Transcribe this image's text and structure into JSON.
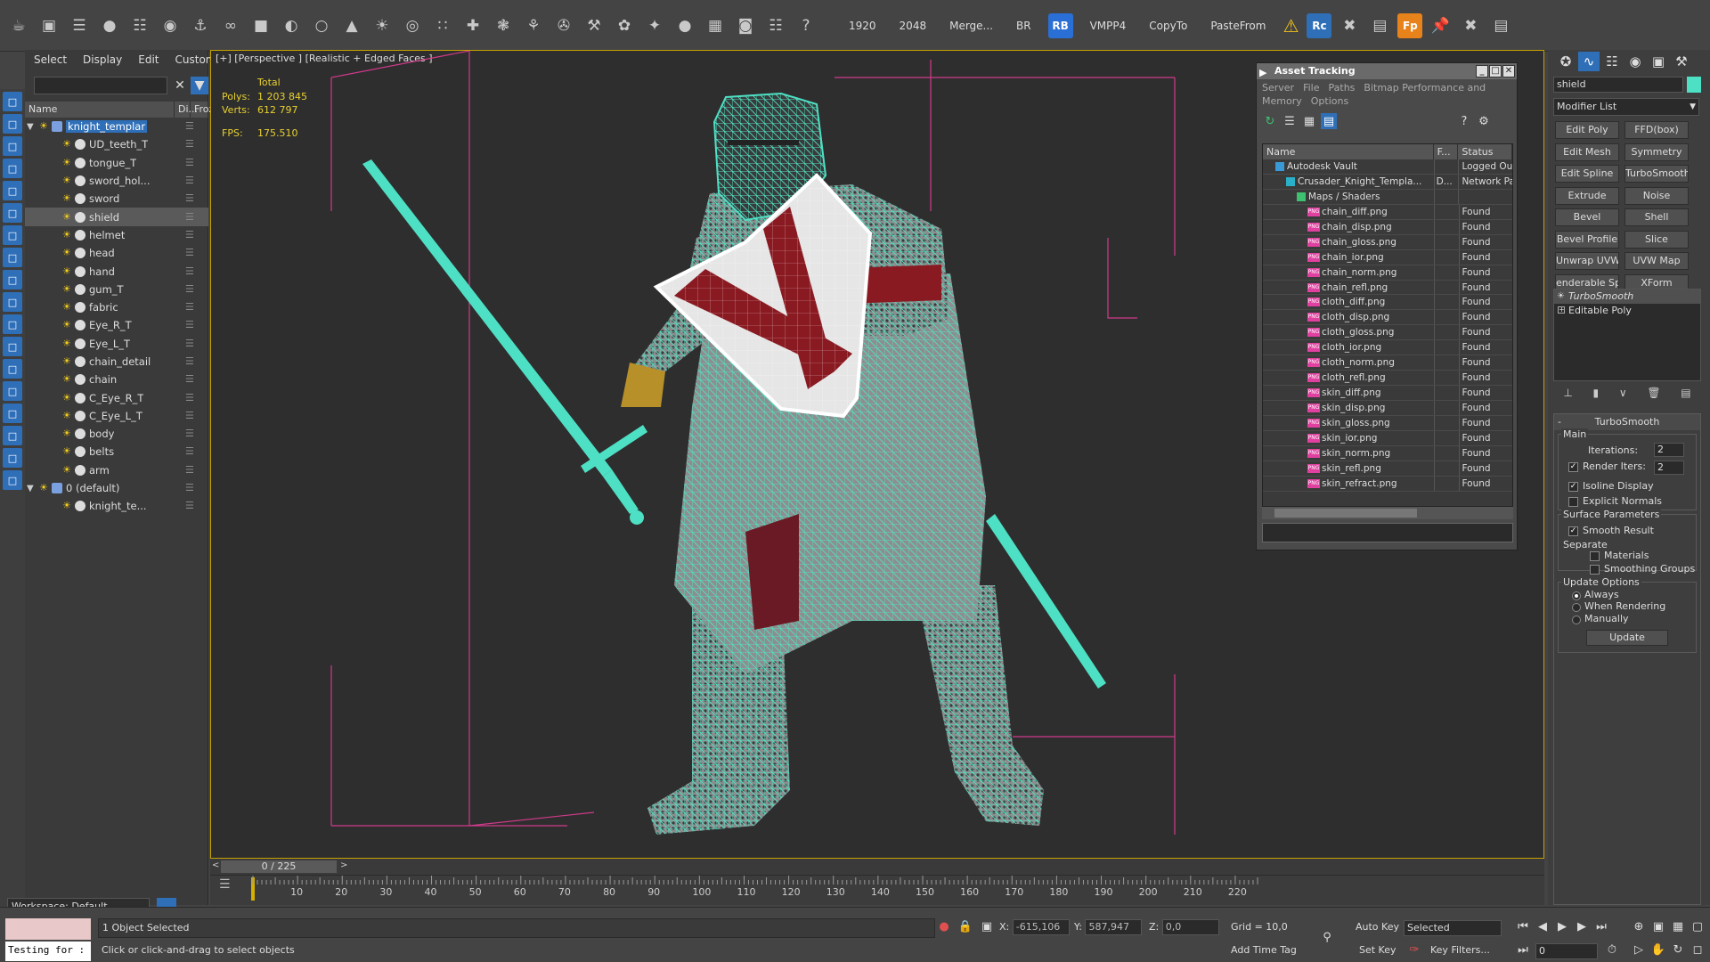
{
  "toolbar": {
    "icons": [
      "teapot-icon",
      "render-frame-icon",
      "render-setup-icon",
      "material-editor-icon",
      "scene-explorer-icon",
      "layer-icon",
      "link-icon",
      "bind-icon",
      "box-icon",
      "sphere-icon",
      "cylinder-icon",
      "cone-icon",
      "light-icon",
      "camera-icon",
      "particle-icon",
      "helper-icon",
      "space-warp-icon",
      "system-icon",
      "plugin-icon",
      "tool-icon",
      "tool2-icon",
      "tool3-icon",
      "globe-icon",
      "compact-icon",
      "sphere-blue-icon",
      "table-icon",
      "help-icon"
    ],
    "labels": [
      "1920",
      "2048",
      "Merge...",
      "BR"
    ],
    "rb": "RB",
    "labels2": [
      "VMPP4",
      "CopyTo",
      "PasteFrom"
    ],
    "rc": "Rc",
    "fp": "Fp"
  },
  "scene": {
    "menu": [
      "Select",
      "Display",
      "Edit",
      "Customize"
    ],
    "header": {
      "name": "Name",
      "disp": "Di...",
      "frozen": "Froze"
    },
    "items": [
      {
        "label": "knight_templar",
        "level": 1,
        "type": "root"
      },
      {
        "label": "UD_teeth_T",
        "level": 2,
        "type": "obj"
      },
      {
        "label": "tongue_T",
        "level": 2,
        "type": "obj"
      },
      {
        "label": "sword_hol...",
        "level": 2,
        "type": "obj"
      },
      {
        "label": "sword",
        "level": 2,
        "type": "obj"
      },
      {
        "label": "shield",
        "level": 2,
        "type": "obj",
        "selected": true
      },
      {
        "label": "helmet",
        "level": 2,
        "type": "obj"
      },
      {
        "label": "head",
        "level": 2,
        "type": "obj"
      },
      {
        "label": "hand",
        "level": 2,
        "type": "obj"
      },
      {
        "label": "gum_T",
        "level": 2,
        "type": "obj"
      },
      {
        "label": "fabric",
        "level": 2,
        "type": "obj"
      },
      {
        "label": "Eye_R_T",
        "level": 2,
        "type": "obj"
      },
      {
        "label": "Eye_L_T",
        "level": 2,
        "type": "obj"
      },
      {
        "label": "chain_detail",
        "level": 2,
        "type": "obj"
      },
      {
        "label": "chain",
        "level": 2,
        "type": "obj"
      },
      {
        "label": "C_Eye_R_T",
        "level": 2,
        "type": "obj"
      },
      {
        "label": "C_Eye_L_T",
        "level": 2,
        "type": "obj"
      },
      {
        "label": "body",
        "level": 2,
        "type": "obj"
      },
      {
        "label": "belts",
        "level": 2,
        "type": "obj"
      },
      {
        "label": "arm",
        "level": 2,
        "type": "obj"
      },
      {
        "label": "0 (default)",
        "level": 1,
        "type": "root"
      },
      {
        "label": "knight_te...",
        "level": 2,
        "type": "layerobj"
      }
    ],
    "workspace": "Workspace: Default"
  },
  "viewport": {
    "label": "[+] [Perspective ] [Realistic + Edged Faces ]",
    "stats": {
      "total_label": "Total",
      "polys_label": "Polys:",
      "polys": "1 203 845",
      "verts_label": "Verts:",
      "verts": "612 797",
      "fps_label": "FPS:",
      "fps": "175.510"
    }
  },
  "timeline": {
    "slider": "0 / 225",
    "ticks": [
      "10",
      "20",
      "30",
      "40",
      "50",
      "60",
      "70",
      "80",
      "90",
      "100",
      "110",
      "120",
      "130",
      "140",
      "150",
      "160",
      "170",
      "180",
      "190",
      "200",
      "210",
      "220"
    ]
  },
  "asset": {
    "title": "Asset Tracking",
    "menu": [
      "Server",
      "File",
      "Paths",
      "Bitmap Performance and Memory",
      "Options"
    ],
    "columns": [
      "Name",
      "F...",
      "Status"
    ],
    "rows": [
      {
        "name": "Autodesk Vault",
        "f": "",
        "status": "Logged Out",
        "indent": 1,
        "kind": "vault"
      },
      {
        "name": "Crusader_Knight_Templa...",
        "f": "D...",
        "status": "Network Pat",
        "indent": 2,
        "kind": "max"
      },
      {
        "name": "Maps / Shaders",
        "f": "",
        "status": "",
        "indent": 3,
        "kind": "maps"
      },
      {
        "name": "chain_diff.png",
        "f": "",
        "status": "Found",
        "indent": 4,
        "kind": "png"
      },
      {
        "name": "chain_disp.png",
        "f": "",
        "status": "Found",
        "indent": 4,
        "kind": "png"
      },
      {
        "name": "chain_gloss.png",
        "f": "",
        "status": "Found",
        "indent": 4,
        "kind": "png"
      },
      {
        "name": "chain_ior.png",
        "f": "",
        "status": "Found",
        "indent": 4,
        "kind": "png"
      },
      {
        "name": "chain_norm.png",
        "f": "",
        "status": "Found",
        "indent": 4,
        "kind": "png"
      },
      {
        "name": "chain_refl.png",
        "f": "",
        "status": "Found",
        "indent": 4,
        "kind": "png"
      },
      {
        "name": "cloth_diff.png",
        "f": "",
        "status": "Found",
        "indent": 4,
        "kind": "png"
      },
      {
        "name": "cloth_disp.png",
        "f": "",
        "status": "Found",
        "indent": 4,
        "kind": "png"
      },
      {
        "name": "cloth_gloss.png",
        "f": "",
        "status": "Found",
        "indent": 4,
        "kind": "png"
      },
      {
        "name": "cloth_ior.png",
        "f": "",
        "status": "Found",
        "indent": 4,
        "kind": "png"
      },
      {
        "name": "cloth_norm.png",
        "f": "",
        "status": "Found",
        "indent": 4,
        "kind": "png"
      },
      {
        "name": "cloth_refl.png",
        "f": "",
        "status": "Found",
        "indent": 4,
        "kind": "png"
      },
      {
        "name": "skin_diff.png",
        "f": "",
        "status": "Found",
        "indent": 4,
        "kind": "png"
      },
      {
        "name": "skin_disp.png",
        "f": "",
        "status": "Found",
        "indent": 4,
        "kind": "png"
      },
      {
        "name": "skin_gloss.png",
        "f": "",
        "status": "Found",
        "indent": 4,
        "kind": "png"
      },
      {
        "name": "skin_ior.png",
        "f": "",
        "status": "Found",
        "indent": 4,
        "kind": "png"
      },
      {
        "name": "skin_norm.png",
        "f": "",
        "status": "Found",
        "indent": 4,
        "kind": "png"
      },
      {
        "name": "skin_refl.png",
        "f": "",
        "status": "Found",
        "indent": 4,
        "kind": "png"
      },
      {
        "name": "skin_refract.png",
        "f": "",
        "status": "Found",
        "indent": 4,
        "kind": "png"
      }
    ]
  },
  "command_panel": {
    "object_name": "shield",
    "object_color": "#4ee0c4",
    "modifier_list": "Modifier List",
    "buttons": [
      "Edit Poly",
      "FFD(box)",
      "Edit Mesh",
      "Symmetry",
      "Edit Spline",
      "TurboSmooth",
      "Extrude",
      "Noise",
      "Bevel",
      "Shell",
      "Bevel Profile",
      "Slice",
      "Unwrap UVW",
      "UVW Map",
      "enderable Splir",
      "XForm"
    ],
    "stack": [
      "TurboSmooth",
      "Editable Poly"
    ],
    "rollout_title": "TurboSmooth",
    "main_label": "Main",
    "iterations_label": "Iterations:",
    "iterations": "2",
    "render_iters_label": "Render Iters:",
    "render_iters": "2",
    "isoline": "Isoline Display",
    "explicit": "Explicit Normals",
    "surface_label": "Surface Parameters",
    "smooth_result": "Smooth Result",
    "separate_label": "Separate",
    "materials": "Materials",
    "smoothing_groups": "Smoothing Groups",
    "update_label": "Update Options",
    "always": "Always",
    "when_rendering": "When Rendering",
    "manually": "Manually",
    "update_button": "Update"
  },
  "status": {
    "maxscript": "Testing for :",
    "selected": "1 Object Selected",
    "prompt": "Click or click-and-drag to select objects",
    "x_label": "X:",
    "x": "-615,106",
    "y_label": "Y:",
    "y": "587,947",
    "z_label": "Z:",
    "z": "0,0",
    "grid": "Grid = 10,0",
    "add_time_tag": "Add Time Tag",
    "auto_key": "Auto Key",
    "set_key": "Set Key",
    "selected_mode": "Selected",
    "key_filters": "Key Filters...",
    "frame": "0"
  },
  "colors": {
    "accent": "#2f6fb8",
    "wire": "#4ee0c4",
    "cross": "#8a1a22",
    "box": "#d03a8a",
    "stats": "#e8d030"
  }
}
